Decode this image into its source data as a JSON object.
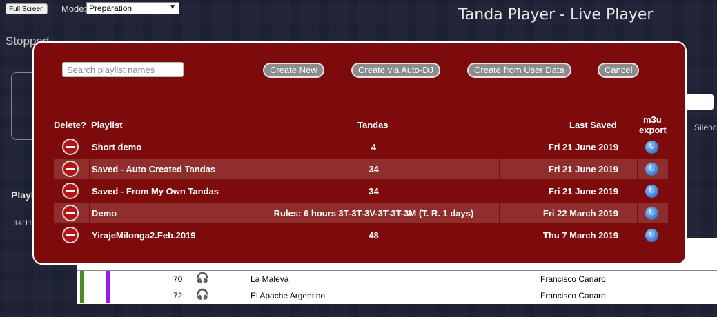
{
  "topbar": {
    "fullscreen_label": "Full Screen",
    "mode_label": "Mode:",
    "mode_value": "Preparation",
    "app_title": "Tanda Player - Live Player"
  },
  "status_text": "Stopped",
  "background": {
    "silence_label": "Silenc",
    "playlist_label": "Playli",
    "time_label": "14:11",
    "tracks": [
      {
        "num": "70",
        "title": "La Maleva",
        "artist": "Francisco Canaro"
      },
      {
        "num": "72",
        "title": "El Apache Argentino",
        "artist": "Francisco Canaro"
      }
    ]
  },
  "modal": {
    "search_placeholder": "Search playlist names",
    "buttons": {
      "create_new": "Create New",
      "create_autodj": "Create via Auto-DJ",
      "create_user_data": "Create from User Data",
      "cancel": "Cancel"
    },
    "headers": {
      "delete": "Delete?",
      "playlist": "Playlist",
      "tandas": "Tandas",
      "last_saved": "Last Saved",
      "m3u_line1": "m3u",
      "m3u_line2": "export"
    },
    "playlists": [
      {
        "name": "Short demo",
        "tandas": "4",
        "last_saved": "Fri 21 June 2019"
      },
      {
        "name": "Saved - Auto Created Tandas",
        "tandas": "34",
        "last_saved": "Fri 21 June 2019"
      },
      {
        "name": "Saved - From My Own Tandas",
        "tandas": "34",
        "last_saved": "Fri 21 June 2019"
      },
      {
        "name": "Demo",
        "tandas": "Rules: 6 hours 3T-3T-3V-3T-3T-3M (T. R. 1 days)",
        "last_saved": "Fri 22 March 2019"
      },
      {
        "name": "YirajeMilonga2.Feb.2019",
        "tandas": "48",
        "last_saved": "Thu 7 March 2019"
      }
    ]
  },
  "icons": {
    "delete": "minus-circle-icon",
    "m3u": "export-arrow-icon",
    "headphones": "headphones-icon"
  }
}
